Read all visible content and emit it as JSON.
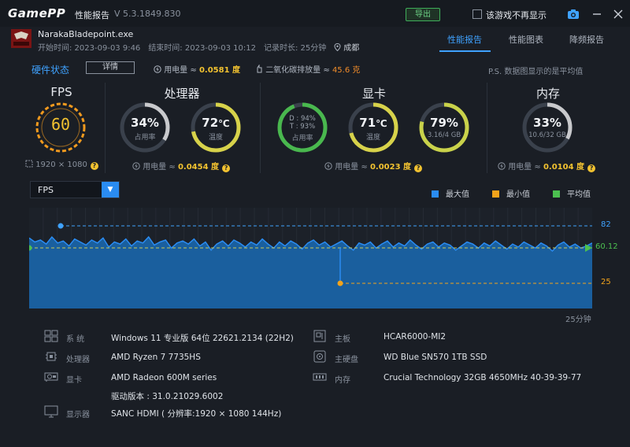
{
  "titlebar": {
    "logo": "GamePP",
    "title": "性能报告",
    "version": "V 5.3.1849.830",
    "export_label": "导出",
    "noshow_label": "该游戏不再显示"
  },
  "app": {
    "name": "NarakaBladepoint.exe",
    "start": "开始时间: 2023-09-03 9:46",
    "end": "结束时间: 2023-09-03 10:12",
    "duration": "记录时长: 25分钟",
    "location": "成都"
  },
  "tabs": [
    {
      "label": "性能报告",
      "active": true
    },
    {
      "label": "性能图表",
      "active": false
    },
    {
      "label": "降频报告",
      "active": false
    }
  ],
  "hw": {
    "title": "硬件状态",
    "detail_label": "详情",
    "power_prefix": "用电量 ≈",
    "power_value": "0.0581 度",
    "co2_prefix": "二氧化碳排放量 ≈",
    "co2_value": "45.6 克",
    "note": "P.S. 数据图显示的是平均值"
  },
  "fps": {
    "title": "FPS",
    "value": "60",
    "resolution": "1920 × 1080"
  },
  "cpu": {
    "title": "处理器",
    "usage": "34%",
    "usage_frac": 0.34,
    "usage_label": "占用率",
    "temp": "72",
    "temp_unit": "℃",
    "temp_frac": 0.72,
    "temp_label": "温度",
    "power_prefix": "用电量 ≈",
    "power_value": "0.0454 度"
  },
  "gpu": {
    "title": "显卡",
    "d_line": "D : 94%",
    "t_line": "T : 93%",
    "usage_frac": 0.94,
    "usage_label": "占用率",
    "temp": "71",
    "temp_unit": "℃",
    "temp_frac": 0.71,
    "temp_label": "温度",
    "vram": "79%",
    "vram_frac": 0.79,
    "vram_sub": "3.16/4 GB",
    "power_prefix": "用电量 ≈",
    "power_value": "0.0023 度"
  },
  "mem": {
    "title": "内存",
    "usage": "33%",
    "usage_frac": 0.33,
    "sub": "10.6/32 GB",
    "power_prefix": "用电量 ≈",
    "power_value": "0.0104 度"
  },
  "chart_controls": {
    "metric": "FPS",
    "legend": [
      {
        "label": "最大值",
        "color": "#2a8cf2"
      },
      {
        "label": "最小值",
        "color": "#f2a31b"
      },
      {
        "label": "平均值",
        "color": "#4cc050"
      }
    ],
    "x_end_label": "25分钟"
  },
  "chart_data": {
    "type": "area",
    "x_end": "25分钟",
    "ylim": [
      0,
      100
    ],
    "max": 82,
    "min": 25,
    "avg": 60.12,
    "max_label": "82",
    "min_label": "25",
    "avg_label": "60.12",
    "series": [
      {
        "values": [
          70,
          66,
          68,
          64,
          71,
          65,
          67,
          62,
          69,
          66,
          63,
          68,
          65,
          70,
          61,
          66,
          64,
          69,
          62,
          67,
          65,
          71,
          63,
          66,
          68,
          60,
          65,
          67,
          64,
          69,
          62,
          66,
          58,
          64,
          67,
          62,
          68,
          65,
          61,
          66,
          63,
          69,
          64,
          60,
          66,
          62,
          67,
          64,
          59,
          65,
          68,
          63,
          66,
          61,
          64,
          67,
          62,
          58,
          65,
          63,
          66,
          60,
          64,
          67,
          61,
          65,
          62,
          68,
          63,
          59,
          64,
          66,
          61,
          65,
          63,
          58,
          62,
          66,
          64,
          60,
          65,
          62,
          67,
          63,
          59,
          64,
          61,
          66,
          63,
          60,
          65,
          62,
          57,
          63,
          66,
          61,
          64,
          60,
          62,
          65
        ]
      }
    ]
  },
  "sysinfo": {
    "os_label": "系 统",
    "os": "Windows 11 专业版 64位 22621.2134 (22H2)",
    "cpu_label": "处理器",
    "cpu": "AMD Ryzen 7 7735HS",
    "gpu_label": "显卡",
    "gpu": "AMD Radeon 600M series",
    "driver": "驱动版本 : 31.0.21029.6002",
    "display_label": "显示器",
    "display": "SANC HDMI ( 分辨率:1920 × 1080 144Hz)",
    "board_label": "主板",
    "board": "HCAR6000-MI2",
    "disk_label": "主硬盘",
    "disk": "WD Blue SN570 1TB SSD",
    "ram_label": "内存",
    "ram": "Crucial Technology 32GB 4650MHz 40-39-39-77"
  }
}
